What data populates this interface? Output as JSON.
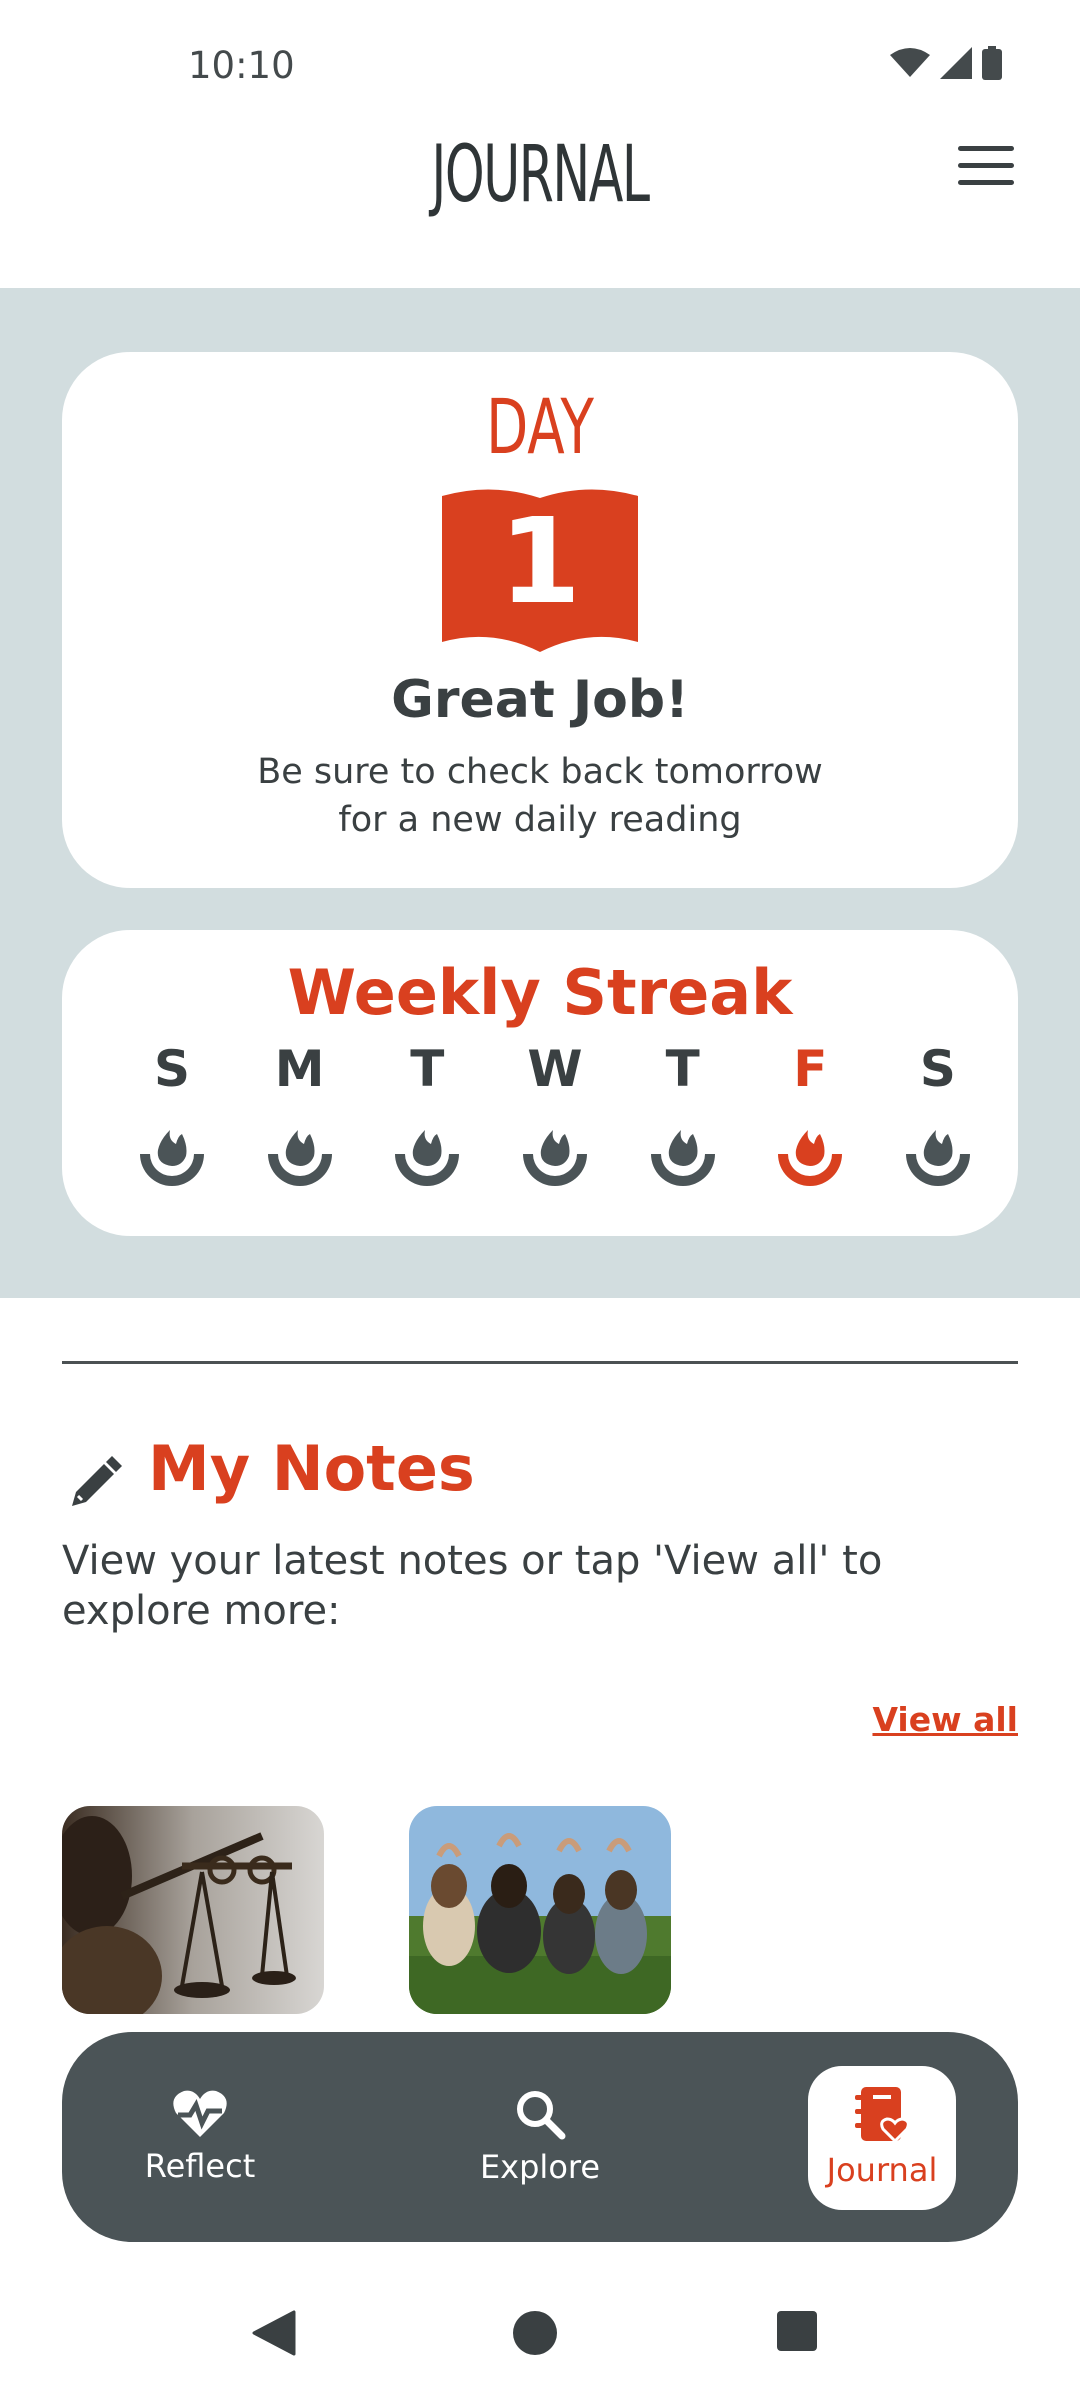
{
  "status_bar": {
    "time": "10:10"
  },
  "header": {
    "title": "JOURNAL"
  },
  "day_card": {
    "label": "DAY",
    "number": "1",
    "headline": "Great Job!",
    "message": "Be sure to check back tomorrow for a new daily reading"
  },
  "streak": {
    "title": "Weekly Streak",
    "days": [
      "S",
      "M",
      "T",
      "W",
      "T",
      "F",
      "S"
    ],
    "active_index": 5
  },
  "notes": {
    "title": "My Notes",
    "description": "View your latest notes or tap 'View all' to explore more:",
    "view_all": "View all",
    "thumbnails": [
      "scales-of-justice-image",
      "friends-heart-hands-image"
    ]
  },
  "bottom_nav": {
    "items": [
      {
        "label": "Reflect",
        "icon": "heart-pulse-icon"
      },
      {
        "label": "Explore",
        "icon": "search-icon"
      },
      {
        "label": "Journal",
        "icon": "journal-icon"
      }
    ],
    "active_index": 2
  },
  "colors": {
    "accent": "#d9401f",
    "band": "#d2dddf",
    "dark": "#3a4042",
    "nav": "#4b5457"
  }
}
